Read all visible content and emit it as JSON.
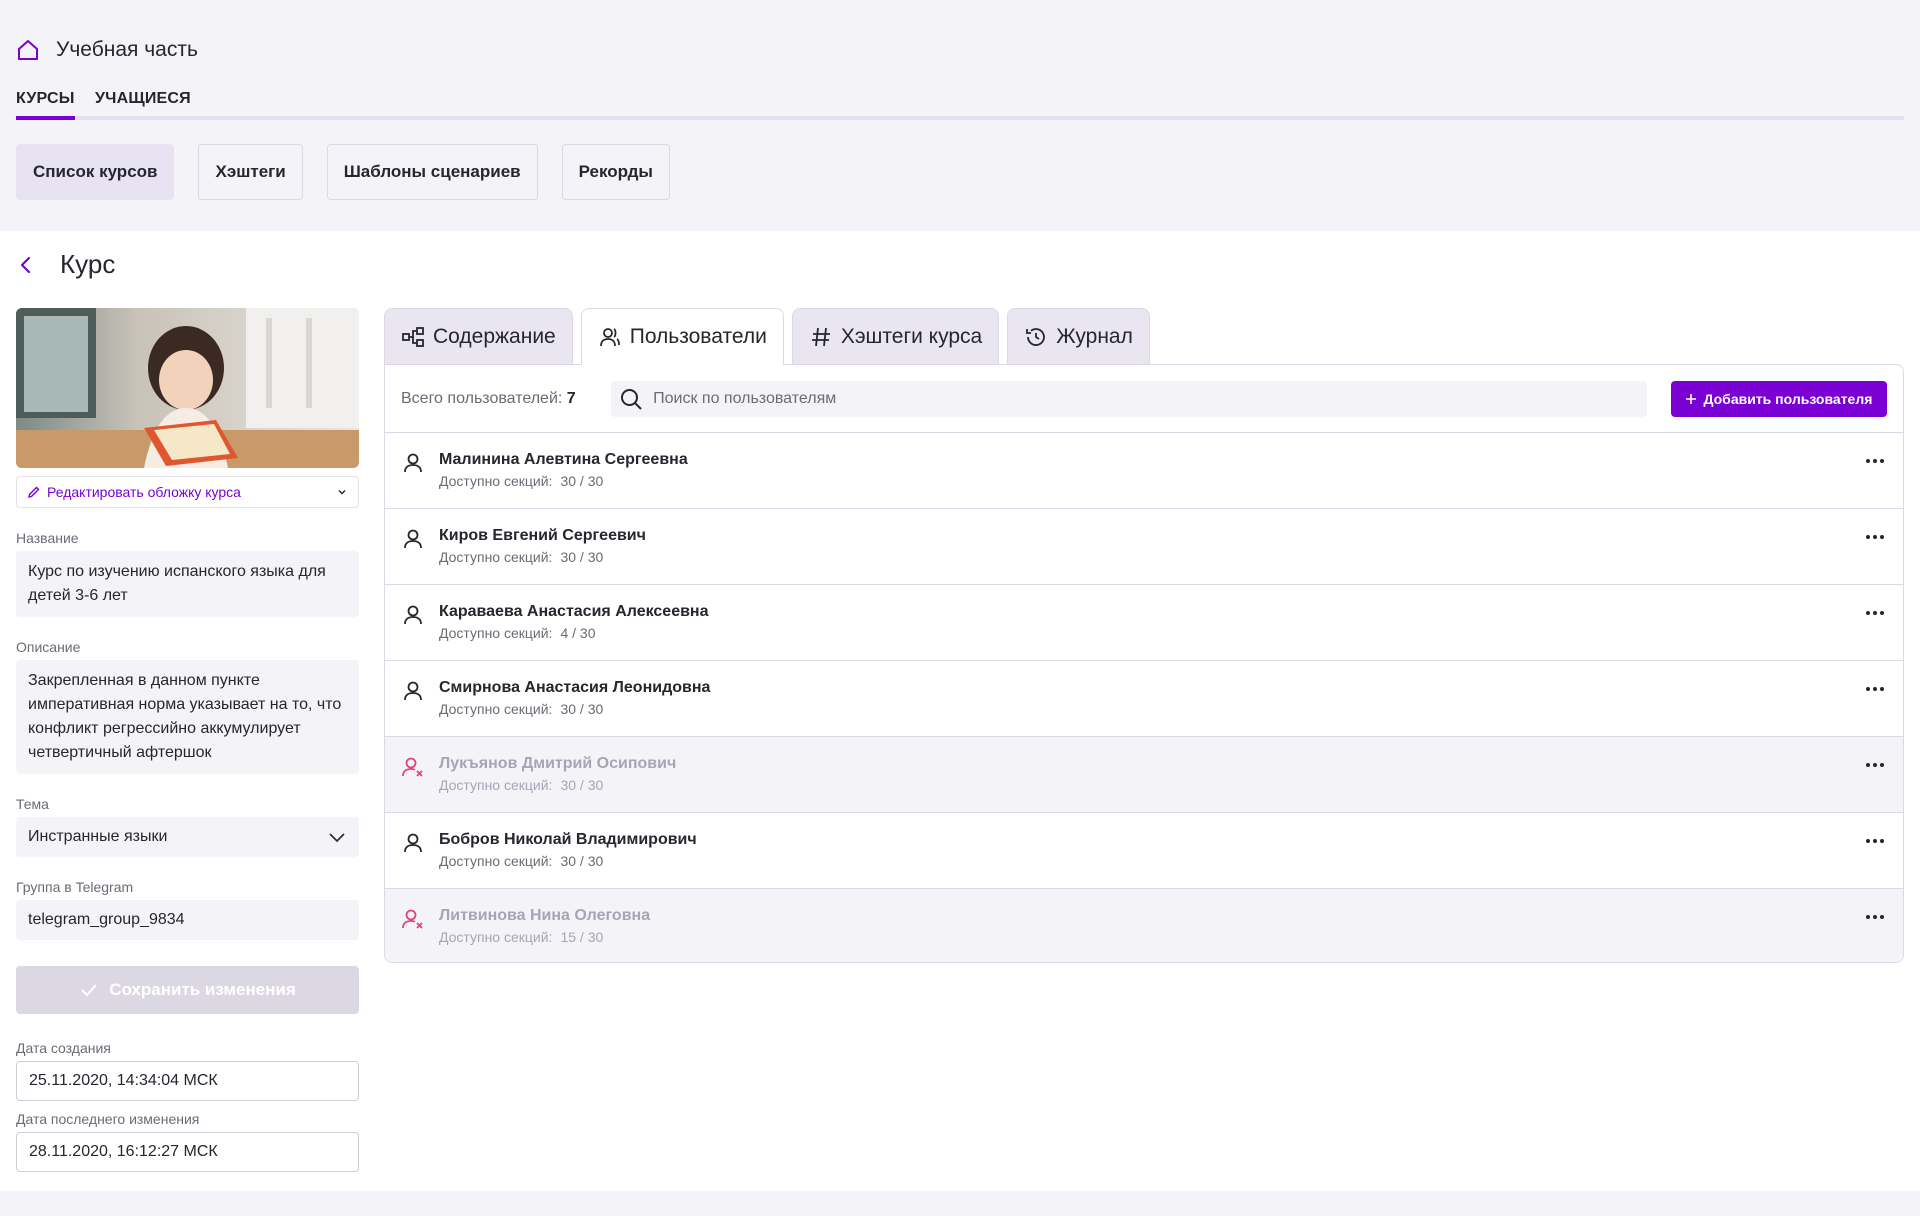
{
  "header": {
    "title": "Учебная часть",
    "tabs": [
      {
        "label": "КУРСЫ",
        "active": true
      },
      {
        "label": "УЧАЩИЕСЯ",
        "active": false
      }
    ],
    "subnav": [
      {
        "label": "Список курсов",
        "active": true
      },
      {
        "label": "Хэштеги",
        "active": false
      },
      {
        "label": "Шаблоны сценариев",
        "active": false
      },
      {
        "label": "Рекорды",
        "active": false
      }
    ]
  },
  "page": {
    "title": "Курс"
  },
  "course": {
    "edit_cover_label": "Редактировать обложку курса",
    "name_label": "Название",
    "name_value": "Курс по изучению испанского языка для детей 3-6 лет",
    "description_label": "Описание",
    "description_value": "Закрепленная в данном пункте императивная норма указывает на то, что конфликт регрессийно аккумулирует четвертичный афтершок",
    "theme_label": "Тема",
    "theme_value": "Инстранные языки",
    "telegram_label": "Группа в Telegram",
    "telegram_value": "telegram_group_9834",
    "save_label": "Сохранить изменения",
    "created_label": "Дата создания",
    "created_value": "25.11.2020, 14:34:04 МСК",
    "modified_label": "Дата последнего изменения",
    "modified_value": "28.11.2020, 16:12:27 МСК"
  },
  "content_tabs": [
    {
      "label": "Содержание",
      "icon": "structure-icon",
      "active": false
    },
    {
      "label": "Пользователи",
      "icon": "users-icon",
      "active": true
    },
    {
      "label": "Хэштеги курса",
      "icon": "hashtag-icon",
      "active": false
    },
    {
      "label": "Журнал",
      "icon": "history-icon",
      "active": false
    }
  ],
  "users_panel": {
    "total_label": "Всего пользователей:",
    "total_value": "7",
    "search_placeholder": "Поиск по пользователям",
    "add_label": "Добавить пользователя",
    "sections_label": "Доступно секций:",
    "users": [
      {
        "name": "Малинина Алевтина Сергеевна",
        "sections": "30 / 30",
        "blocked": false
      },
      {
        "name": "Киров Евгений Сергеевич",
        "sections": "30 / 30",
        "blocked": false
      },
      {
        "name": "Караваева Анастасия Алексеевна",
        "sections": "4 / 30",
        "blocked": false
      },
      {
        "name": "Смирнова Анастасия Леонидовна",
        "sections": "30 / 30",
        "blocked": false
      },
      {
        "name": "Лукъянов Дмитрий Осипович",
        "sections": "30 / 30",
        "blocked": true
      },
      {
        "name": "Бобров Николай Владимирович",
        "sections": "30 / 30",
        "blocked": false
      },
      {
        "name": "Литвинова Нина Олеговна",
        "sections": "15 / 30",
        "blocked": true
      }
    ]
  },
  "colors": {
    "accent": "#7b00d3",
    "blocked_icon": "#e0457b",
    "page_bg": "#f4f3f8"
  }
}
